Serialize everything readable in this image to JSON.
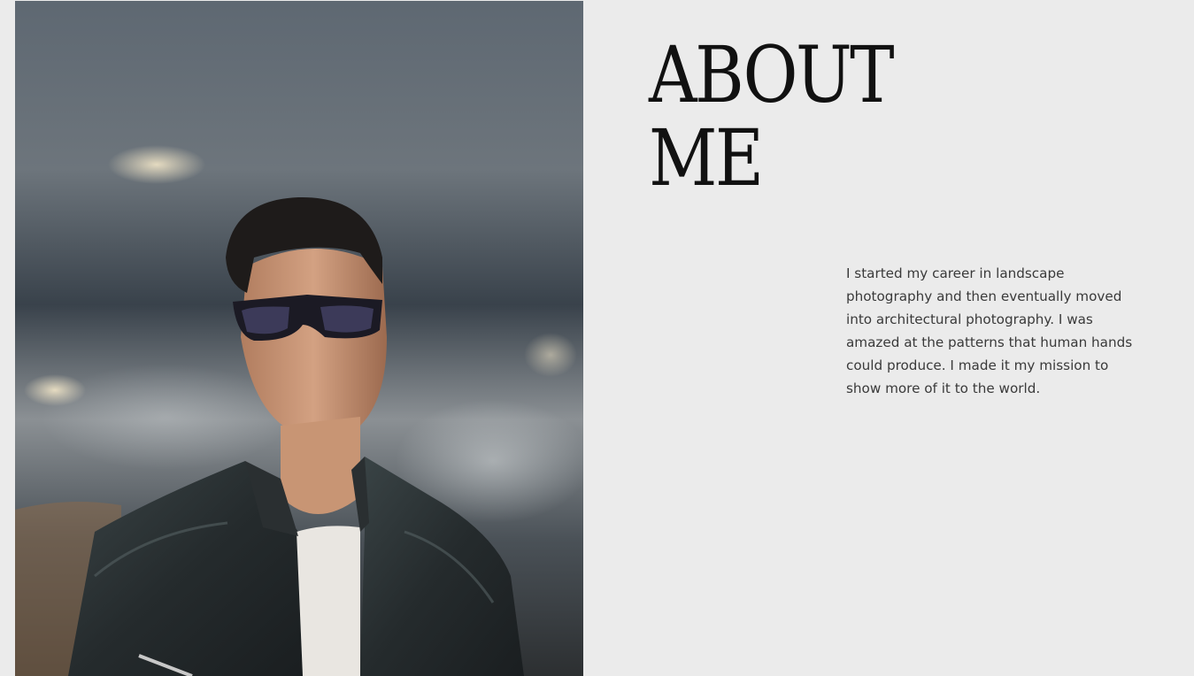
{
  "about": {
    "heading_line1": "ABOUT",
    "heading_line2": "ME",
    "bio": "I started my career in landscape photography and then eventually moved into architectural photography. I was amazed at the patterns that human hands could produce. I made it my mission to show more of it to the world."
  },
  "colors": {
    "background": "#ebebeb",
    "heading": "#111111",
    "body_text": "#3a3a3a"
  }
}
